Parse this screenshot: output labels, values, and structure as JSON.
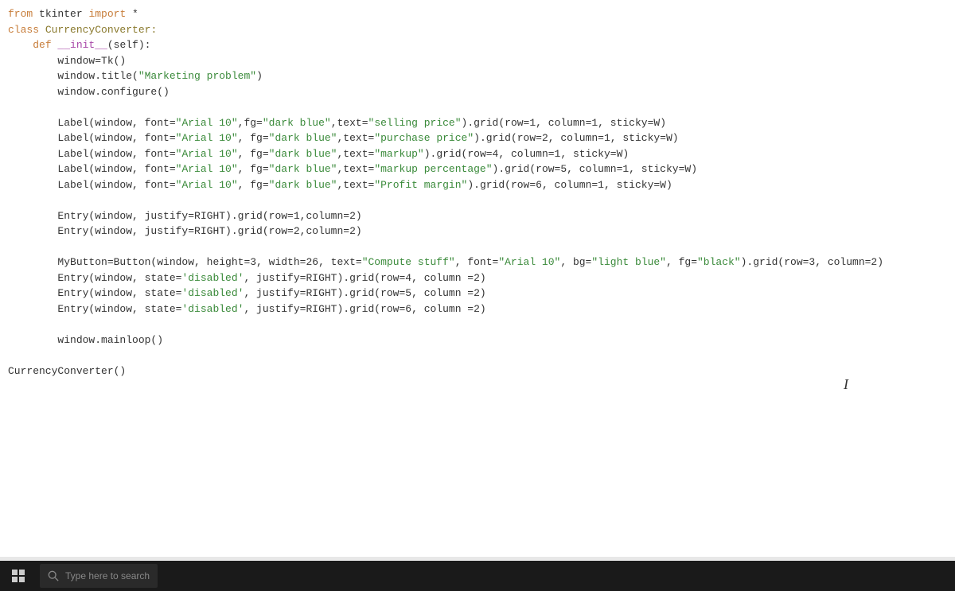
{
  "code": {
    "line1": {
      "kw1": "from",
      "mod": " tkinter ",
      "kw2": "import",
      "star": " *"
    },
    "line2": {
      "kw": "class",
      "name": " CurrencyConverter:"
    },
    "line3": {
      "indent": "    ",
      "kw": "def",
      "name": " __init__",
      "args": "(self):"
    },
    "line4": "        window=Tk()",
    "line5": {
      "pre": "        window.title(",
      "str": "\"Marketing problem\"",
      "post": ")"
    },
    "line6": "        window.configure()",
    "blank1": "",
    "label1": {
      "pre": "        Label(window, font=",
      "s1": "\"Arial 10\"",
      "mid1": ",fg=",
      "s2": "\"dark blue\"",
      "mid2": ",text=",
      "s3": "\"selling price\"",
      "post": ").grid(row=1, column=1, sticky=W)"
    },
    "label2": {
      "pre": "        Label(window, font=",
      "s1": "\"Arial 10\"",
      "mid1": ", fg=",
      "s2": "\"dark blue\"",
      "mid2": ",text=",
      "s3": "\"purchase price\"",
      "post": ").grid(row=2, column=1, sticky=W)"
    },
    "label3": {
      "pre": "        Label(window, font=",
      "s1": "\"Arial 10\"",
      "mid1": ", fg=",
      "s2": "\"dark blue\"",
      "mid2": ",text=",
      "s3": "\"markup\"",
      "post": ").grid(row=4, column=1, sticky=W)"
    },
    "label4": {
      "pre": "        Label(window, font=",
      "s1": "\"Arial 10\"",
      "mid1": ", fg=",
      "s2": "\"dark blue\"",
      "mid2": ",text=",
      "s3": "\"markup percentage\"",
      "post": ").grid(row=5, column=1, sticky=W)"
    },
    "label5": {
      "pre": "        Label(window, font=",
      "s1": "\"Arial 10\"",
      "mid1": ", fg=",
      "s2": "\"dark blue\"",
      "mid2": ",text=",
      "s3": "\"Profit margin\"",
      "post": ").grid(row=6, column=1, sticky=W)"
    },
    "blank2": "",
    "entry1": "        Entry(window, justify=RIGHT).grid(row=1,column=2)",
    "entry2": "        Entry(window, justify=RIGHT).grid(row=2,column=2)",
    "blank3": "",
    "button": {
      "pre": "        MyButton=Button(window, height=3, width=26, text=",
      "s1": "\"Compute stuff\"",
      "mid1": ", font=",
      "s2": "\"Arial 10\"",
      "mid2": ", bg=",
      "s3": "\"light blue\"",
      "mid3": ", fg=",
      "s4": "\"black\"",
      "post": ").grid(row=3, column=2)"
    },
    "entry3": {
      "pre": "        Entry(window, state=",
      "s1": "'disabled'",
      "post": ", justify=RIGHT).grid(row=4, column =2)"
    },
    "entry4": {
      "pre": "        Entry(window, state=",
      "s1": "'disabled'",
      "post": ", justify=RIGHT).grid(row=5, column =2)"
    },
    "entry5": {
      "pre": "        Entry(window, state=",
      "s1": "'disabled'",
      "post": ", justify=RIGHT).grid(row=6, column =2)"
    },
    "blank4": "",
    "mainloop": "        window.mainloop()",
    "blank5": "",
    "call": "CurrencyConverter()"
  },
  "taskbar": {
    "search_placeholder": "Type here to search"
  },
  "cursor_symbol": "I"
}
